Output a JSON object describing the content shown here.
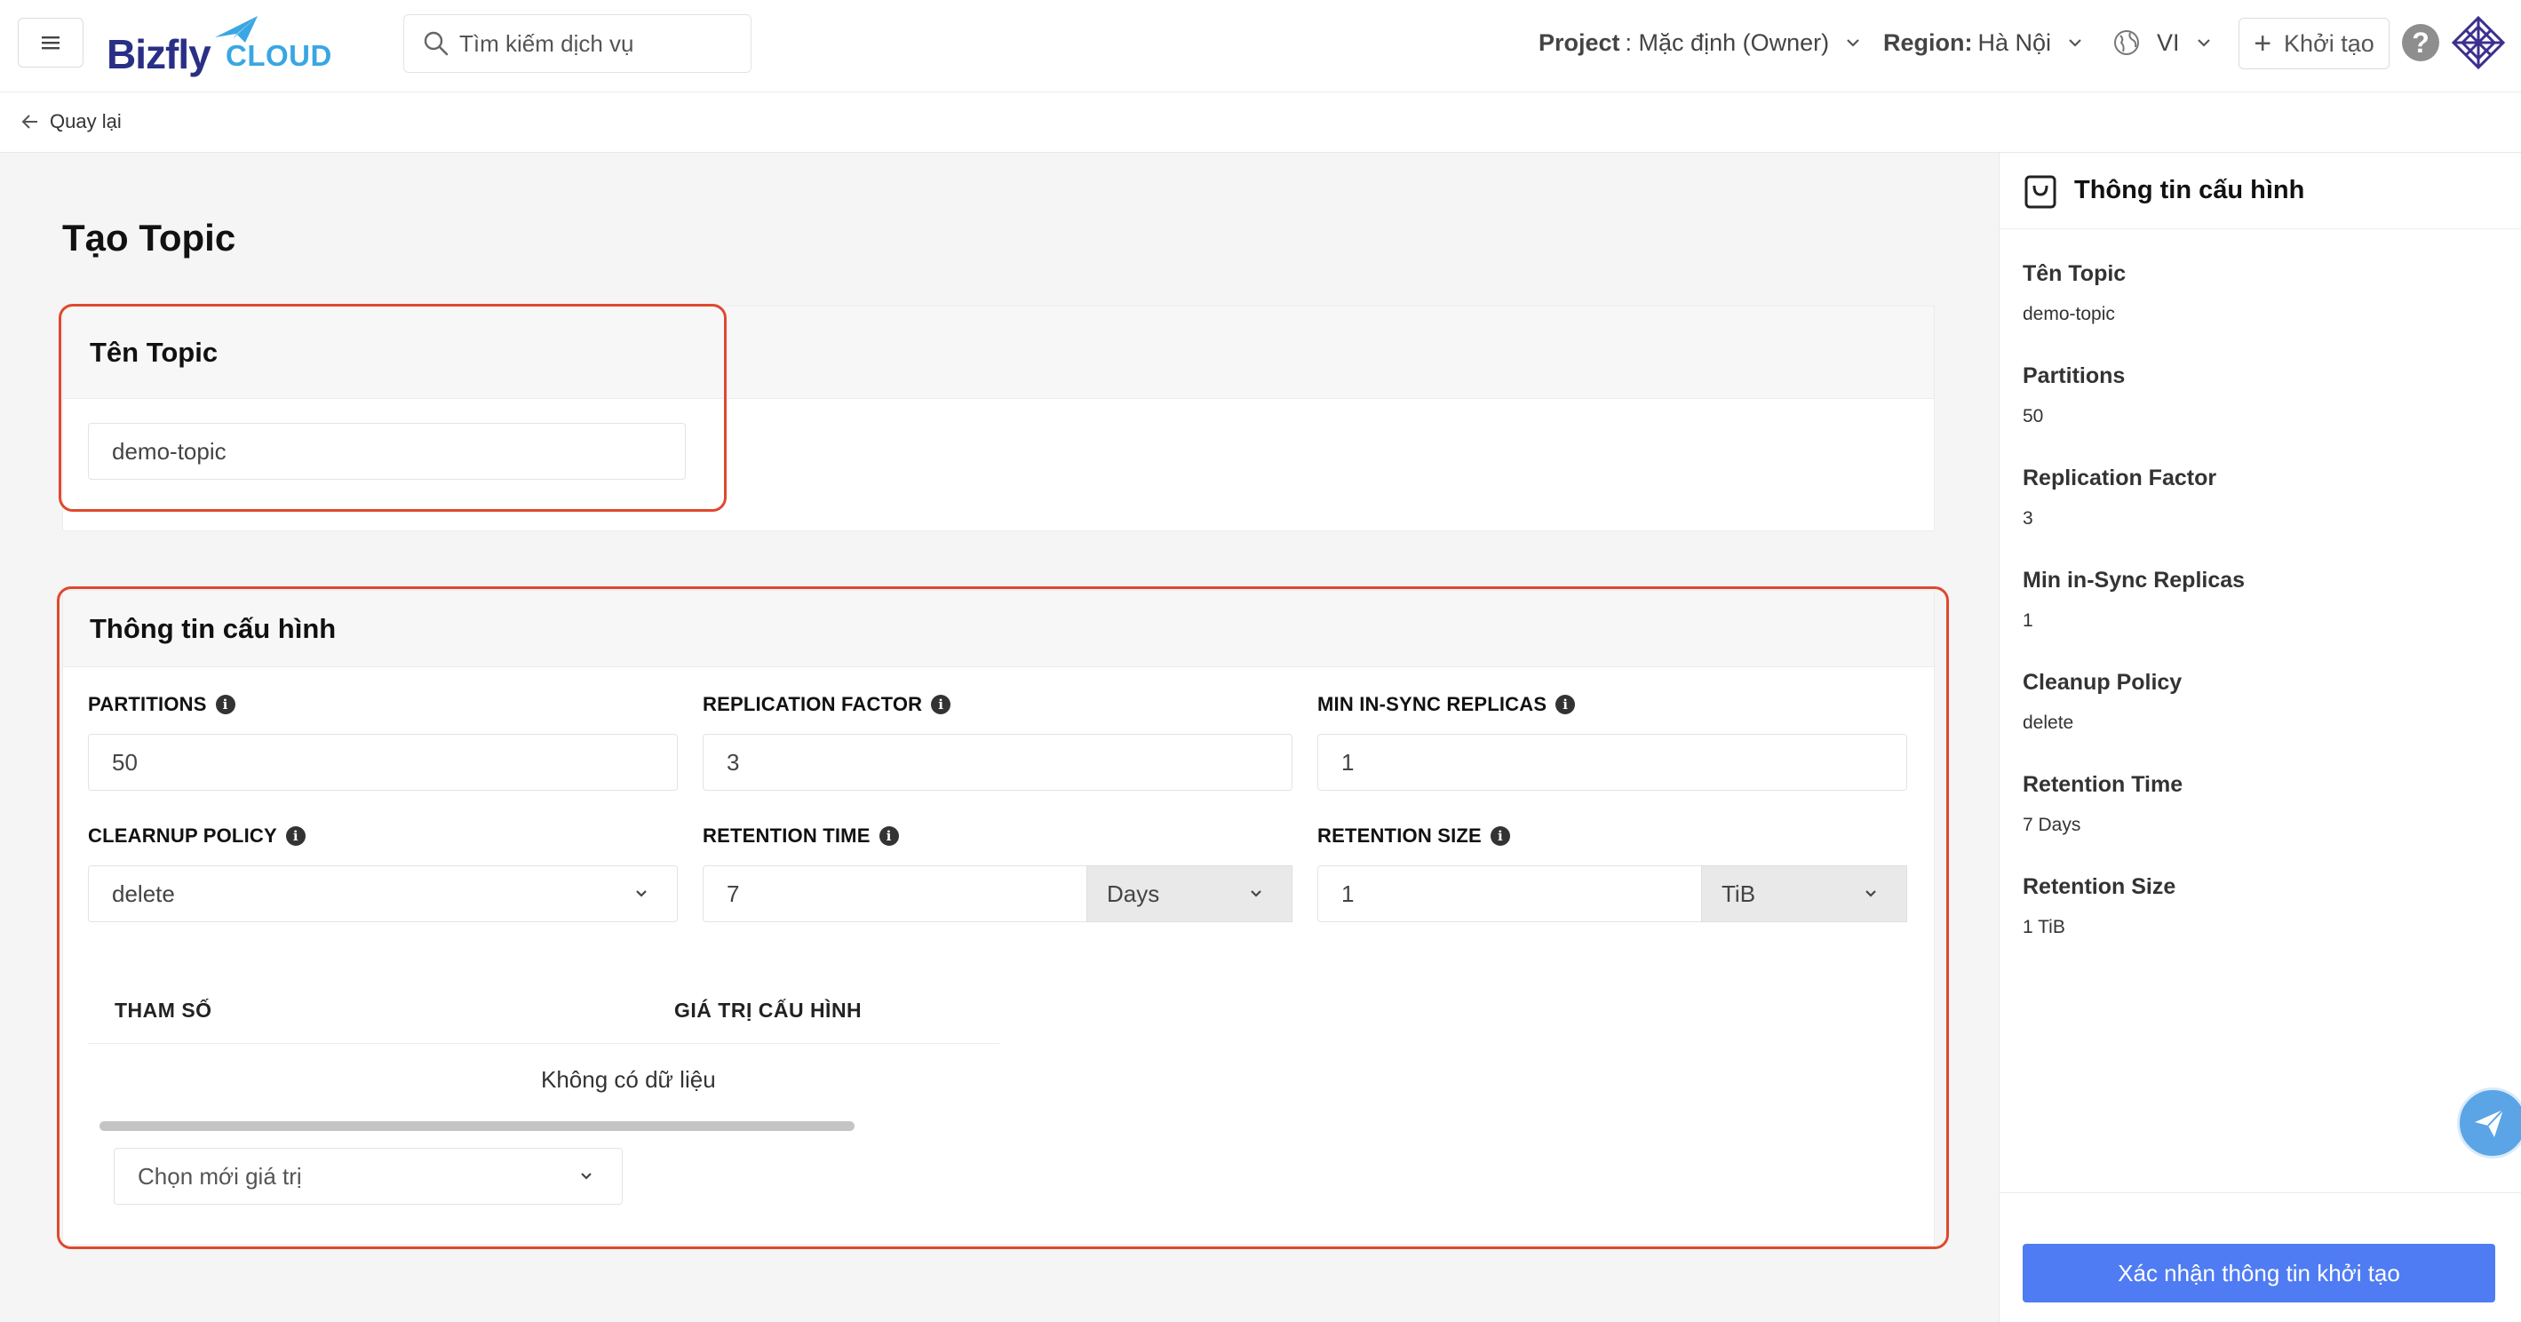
{
  "header": {
    "logo_main": "Bizfly",
    "logo_sub": "CLOUD",
    "search_placeholder": "Tìm kiếm dịch vụ",
    "project_label": "Project",
    "project_value": ": Mặc định (Owner)",
    "region_label": "Region:",
    "region_value": "Hà Nội",
    "language": "VI",
    "create_label": "Khởi tạo",
    "help_label": "?"
  },
  "back": {
    "label": "Quay lại"
  },
  "page": {
    "title": "Tạo Topic"
  },
  "topic_card": {
    "title": "Tên Topic",
    "name_value": "demo-topic"
  },
  "config_card": {
    "title": "Thông tin cấu hình",
    "partitions": {
      "label": "PARTITIONS",
      "value": "50"
    },
    "replication_factor": {
      "label": "REPLICATION FACTOR",
      "value": "3"
    },
    "min_insync": {
      "label": "MIN IN-SYNC REPLICAS",
      "value": "1"
    },
    "cleanup_policy": {
      "label": "CLEARNUP POLICY",
      "value": "delete"
    },
    "retention_time": {
      "label": "RETENTION TIME",
      "value": "7",
      "unit": "Days"
    },
    "retention_size": {
      "label": "RETENTION SIZE",
      "value": "1",
      "unit": "TiB"
    },
    "table": {
      "col_param": "THAM SỐ",
      "col_value": "GIÁ TRỊ CẤU HÌNH",
      "empty": "Không có dữ liệu"
    },
    "new_value_placeholder": "Chọn mới giá trị"
  },
  "summary": {
    "title": "Thông tin cấu hình",
    "items": [
      {
        "label": "Tên Topic",
        "value": "demo-topic"
      },
      {
        "label": "Partitions",
        "value": "50"
      },
      {
        "label": "Replication Factor",
        "value": "3"
      },
      {
        "label": "Min in-Sync Replicas",
        "value": "1"
      },
      {
        "label": "Cleanup Policy",
        "value": "delete"
      },
      {
        "label": "Retention Time",
        "value": "7 Days"
      },
      {
        "label": "Retention Size",
        "value": "1 TiB"
      }
    ],
    "confirm_label": "Xác nhận thông tin khởi tạo"
  },
  "colors": {
    "accent": "#4f7cf3",
    "highlight": "#e0482e",
    "brand_dark": "#2a2f86",
    "brand_light": "#3aa6e3"
  },
  "icons": [
    "menu-icon",
    "search-icon",
    "chevron-down-icon",
    "globe-icon",
    "plus-icon",
    "help-icon",
    "avatar-icon",
    "arrow-left-icon",
    "info-icon",
    "bag-icon",
    "paper-plane-icon"
  ]
}
